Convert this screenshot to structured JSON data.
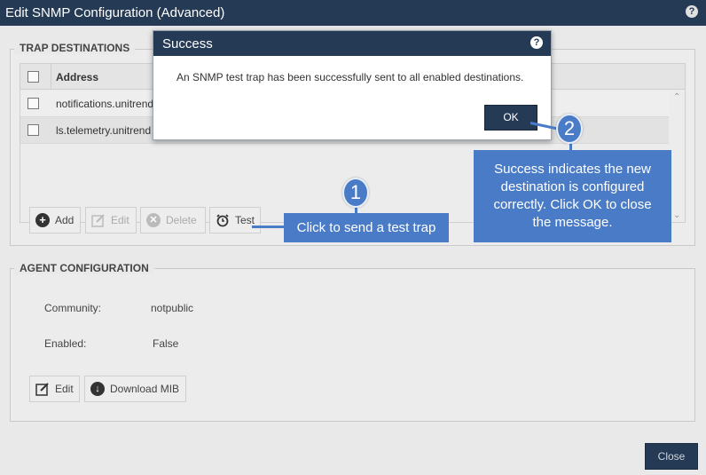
{
  "window": {
    "title": "Edit SNMP Configuration (Advanced)",
    "help_glyph": "?"
  },
  "trap_destinations": {
    "legend": "TRAP DESTINATIONS",
    "column_address": "Address",
    "rows": [
      {
        "address": "notifications.unitrend"
      },
      {
        "address": "ls.telemetry.unitrend"
      }
    ],
    "buttons": {
      "add": "Add",
      "edit": "Edit",
      "delete": "Delete",
      "test": "Test"
    }
  },
  "agent_configuration": {
    "legend": "AGENT CONFIGURATION",
    "community_label": "Community:",
    "community_value": "notpublic",
    "enabled_label": "Enabled:",
    "enabled_value": "False",
    "buttons": {
      "edit": "Edit",
      "download_mib": "Download MIB"
    }
  },
  "footer": {
    "close": "Close"
  },
  "modal": {
    "title": "Success",
    "help_glyph": "?",
    "message": "An SNMP test trap has been successfully sent to all enabled destinations.",
    "ok": "OK"
  },
  "callouts": {
    "one": {
      "number": "1",
      "text": "Click to send a test trap"
    },
    "two": {
      "number": "2",
      "text": "Success indicates the new destination is configured correctly. Click OK to close the message."
    }
  },
  "colors": {
    "titlebar": "#253a55",
    "callout": "#4a7bc7"
  }
}
